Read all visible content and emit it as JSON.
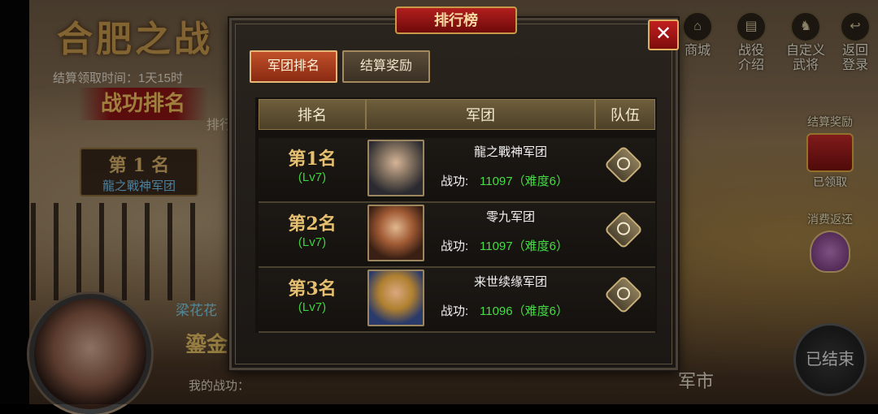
{
  "background": {
    "event_title": "合肥之战",
    "claim_time": "结算领取时间：1天15时",
    "merit_rank_title": "战功排名",
    "rank_label_partial": "排行",
    "rank1_card": {
      "rank": "第 1 名",
      "legion": "龍之戰神军团"
    },
    "hero_name_partial": "梁花花",
    "my_merit": "我的战功：",
    "gold_partial": "鎏金",
    "market_partial": "军市"
  },
  "right_menu": [
    {
      "label": "商城",
      "icon": "shop-icon"
    },
    {
      "label": "战役\n介绍",
      "icon": "battle-info-icon"
    },
    {
      "label": "自定义\n武将",
      "icon": "custom-general-icon"
    },
    {
      "label": "返回\n登录",
      "icon": "return-login-icon"
    }
  ],
  "settle_reward": {
    "title": "结算奖励",
    "status": "已领取"
  },
  "consume_rebate": {
    "title": "消费返还"
  },
  "ended_button": "已结束",
  "dialog": {
    "title": "排行榜",
    "close_symbol": "✕",
    "tabs": [
      {
        "label": "军团排名",
        "active": true
      },
      {
        "label": "结算奖励",
        "active": false
      }
    ],
    "columns": [
      "排名",
      "军团",
      "队伍"
    ],
    "merit_label": "战功:",
    "rows": [
      {
        "rank": "第1名",
        "level": "(Lv7)",
        "legion": "龍之戰神军团",
        "merit": "11097（难度6）"
      },
      {
        "rank": "第2名",
        "level": "(Lv7)",
        "legion": "零九军团",
        "merit": "11097（难度6）"
      },
      {
        "rank": "第3名",
        "level": "(Lv7)",
        "legion": "来世续缘军团",
        "merit": "11096（难度6）"
      }
    ]
  },
  "colors": {
    "gold": "#e6c070",
    "green": "#46dc46",
    "level_green": "#41d040",
    "tab_active": "#c0502a",
    "title_red": "#b21e1e"
  }
}
